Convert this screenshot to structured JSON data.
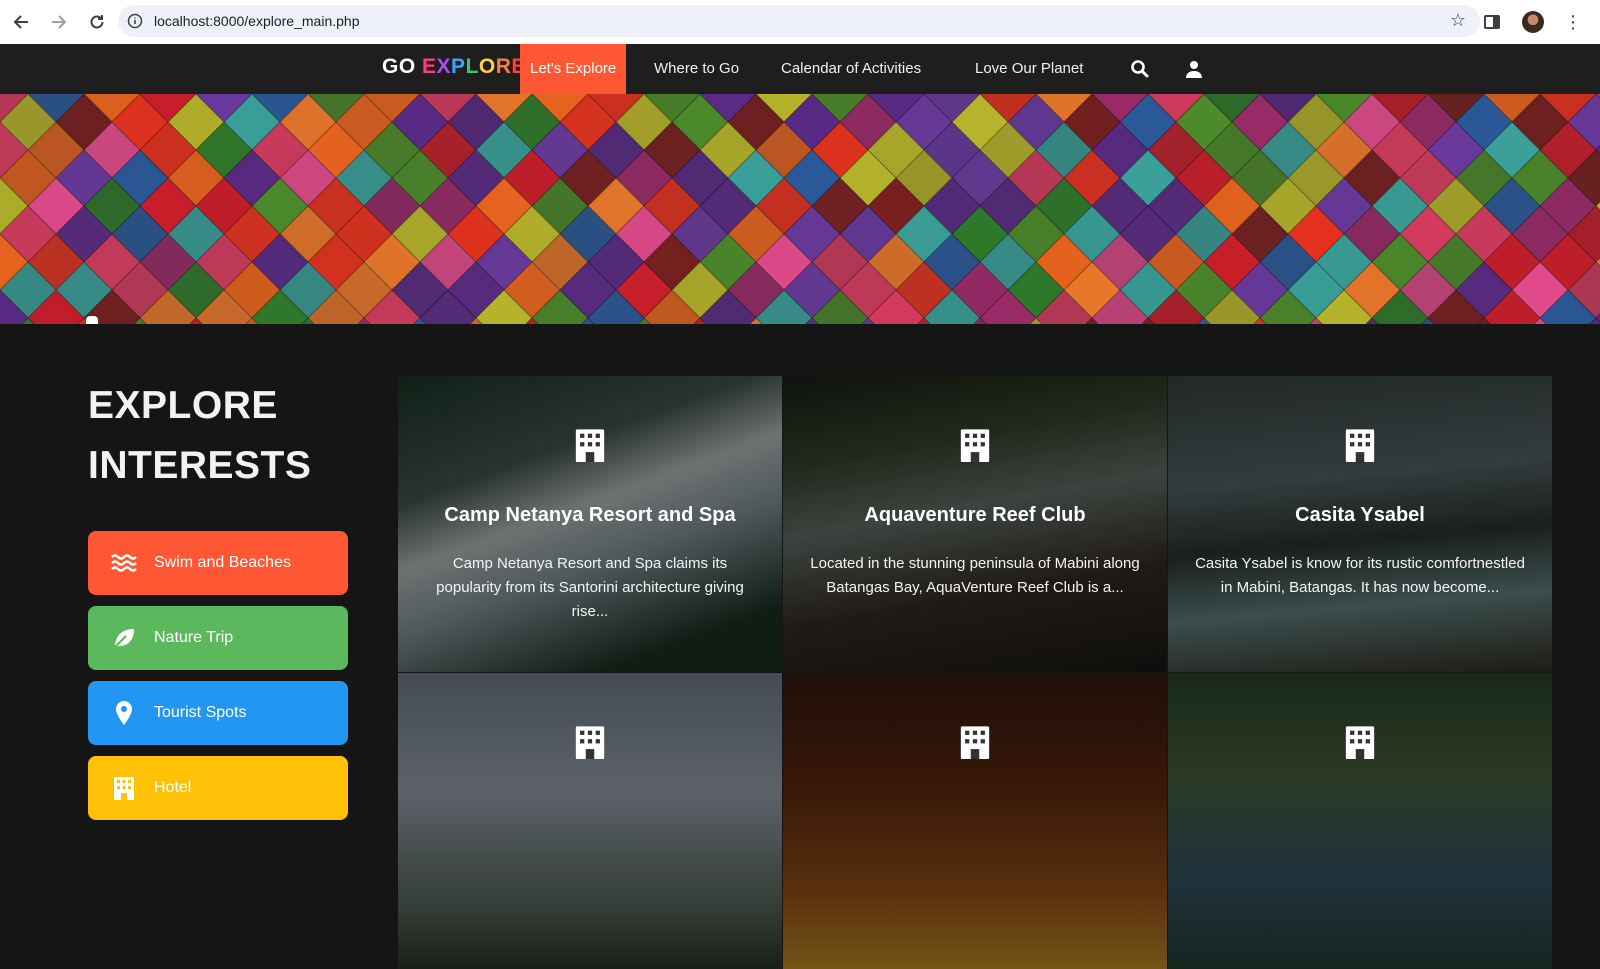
{
  "browser": {
    "url": "localhost:8000/explore_main.php",
    "back_icon": "back-arrow-icon",
    "forward_icon": "forward-arrow-icon",
    "reload_icon": "reload-icon"
  },
  "nav": {
    "logo_go": "GO",
    "logo_explore": [
      "E",
      "X",
      "P",
      "L",
      "O",
      "R",
      "E"
    ],
    "links": [
      "Let's Explore",
      "Where to Go",
      "Calendar of Activities",
      "Love Our Planet"
    ],
    "active": "Let's Explore",
    "accent": "#ff5733"
  },
  "sidebar": {
    "heading_line1": "EXPLORE",
    "heading_line2": "INTERESTS",
    "categories": [
      {
        "label": "Swim and Beaches",
        "color": "#ff5733",
        "icon": "water-waves-icon"
      },
      {
        "label": "Nature Trip",
        "color": "#5cb85c",
        "icon": "leaf-icon"
      },
      {
        "label": "Tourist Spots",
        "color": "#2196f3",
        "icon": "map-pin-icon"
      },
      {
        "label": "Hotel",
        "color": "#ffc107",
        "icon": "hotel-building-icon"
      }
    ]
  },
  "cards": [
    {
      "title": "Camp Netanya Resort and Spa",
      "desc": "Camp Netanya Resort and Spa claims its popularity from its Santorini architecture giving rise..."
    },
    {
      "title": "Aquaventure Reef Club",
      "desc": "Located in the stunning peninsula of Mabini along Batangas Bay, AquaVenture Reef Club is a..."
    },
    {
      "title": "Casita Ysabel",
      "desc": "Casita Ysabel is know for its rustic comfortnestled in Mabini, Batangas. It has now become..."
    },
    {
      "title": "",
      "desc": ""
    },
    {
      "title": "",
      "desc": ""
    },
    {
      "title": "",
      "desc": ""
    }
  ]
}
